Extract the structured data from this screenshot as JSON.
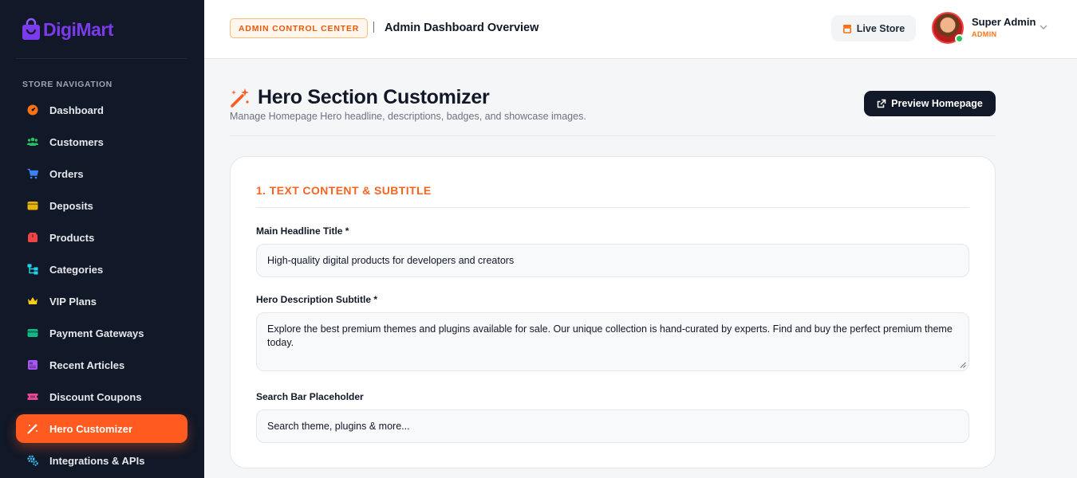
{
  "brand": {
    "part1": "Digi",
    "part2": "Mart"
  },
  "sidebar": {
    "heading": "STORE NAVIGATION",
    "items": [
      {
        "label": "Dashboard",
        "icon": "gauge-icon",
        "color": "#f97316"
      },
      {
        "label": "Customers",
        "icon": "users-icon",
        "color": "#22c55e"
      },
      {
        "label": "Orders",
        "icon": "cart-icon",
        "color": "#3b82f6"
      },
      {
        "label": "Deposits",
        "icon": "wallet-icon",
        "color": "#eab308"
      },
      {
        "label": "Products",
        "icon": "box-icon",
        "color": "#ef4444"
      },
      {
        "label": "Categories",
        "icon": "sitemap-icon",
        "color": "#22d3ee"
      },
      {
        "label": "VIP Plans",
        "icon": "crown-icon",
        "color": "#facc15"
      },
      {
        "label": "Payment Gateways",
        "icon": "credit-card-icon",
        "color": "#10b981"
      },
      {
        "label": "Recent Articles",
        "icon": "newspaper-icon",
        "color": "#a855f7"
      },
      {
        "label": "Discount Coupons",
        "icon": "ticket-icon",
        "color": "#ec4899"
      },
      {
        "label": "Hero Customizer",
        "icon": "magic-wand-icon",
        "color": "#ffffff",
        "active": true
      },
      {
        "label": "Integrations & APIs",
        "icon": "cogs-icon",
        "color": "#38bdf8"
      }
    ]
  },
  "header": {
    "badge": "ADMIN CONTROL CENTER",
    "title": "Admin Dashboard Overview",
    "live_store": "Live Store",
    "user_name": "Super Admin",
    "user_role": "ADMIN"
  },
  "page": {
    "title": "Hero Section Customizer",
    "subtitle": "Manage Homepage Hero headline, descriptions, badges, and showcase images.",
    "preview_button": "Preview Homepage"
  },
  "form": {
    "section_title": "1. TEXT CONTENT & SUBTITLE",
    "headline_label": "Main Headline Title *",
    "headline_value": "High-quality digital products for developers and creators",
    "description_label": "Hero Description Subtitle *",
    "description_value": "Explore the best premium themes and plugins available for sale. Our unique collection is hand-curated by experts. Find and buy the perfect premium theme today.",
    "search_label": "Search Bar Placeholder",
    "search_value": "Search theme, plugins & more..."
  },
  "colors": {
    "accent": "#ff5a1f",
    "sidebar_bg": "#111827",
    "brand": "#7c3aed"
  }
}
